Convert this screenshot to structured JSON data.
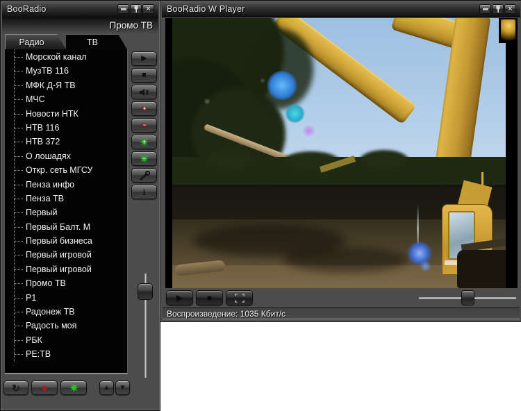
{
  "main_window": {
    "title": "BooRadio",
    "now_playing": "Промо ТВ",
    "tabs": {
      "radio": "Радио",
      "tv": "ТВ",
      "active": "ТВ"
    },
    "channels": [
      "Морской канал",
      "МузТВ 116",
      "МФК Д-Я ТВ",
      "МЧС",
      "Новости НТК",
      "НТВ 116",
      "НТВ 372",
      "О лошадях",
      "Откр. сеть МГСУ",
      "Пенза инфо",
      "Пенза ТВ",
      "Первый",
      "Первый Балт. М",
      "Первый бизнеса",
      "Первый игровой",
      "Первый игровой",
      "Промо ТВ",
      "Р1",
      "Радонеж ТВ",
      "Радость моя",
      "РБК",
      "РЕ:ТВ"
    ],
    "side_buttons": [
      "play",
      "stop",
      "mute",
      "favorite-add",
      "favorite-remove",
      "group-add",
      "group-remove",
      "settings",
      "info"
    ],
    "bottom_buttons": [
      "refresh",
      "favorites",
      "groups",
      "move-up",
      "move-down"
    ],
    "volume_slider": {
      "orientation": "vertical",
      "position_fraction": 0.1
    }
  },
  "player_window": {
    "title": "BooRadio W Player",
    "controls": [
      "play",
      "stop",
      "fullscreen"
    ],
    "status": "Воспроизведение: 1035 Кбит/с",
    "volume_slider": {
      "orientation": "horizontal",
      "position_fraction": 0.45
    }
  },
  "icons": {
    "play": "▶",
    "stop": "■",
    "up": "▲",
    "down": "▼",
    "refresh": "↻",
    "heart": "♥",
    "close": "×",
    "plus": "+",
    "minus": "−",
    "info": "i"
  },
  "colors": {
    "window_gray": "#4c4c4c",
    "list_background": "#030303",
    "heart_red": "#b01020",
    "group_green": "#2db52d",
    "accent_text": "#f2f2f2"
  }
}
